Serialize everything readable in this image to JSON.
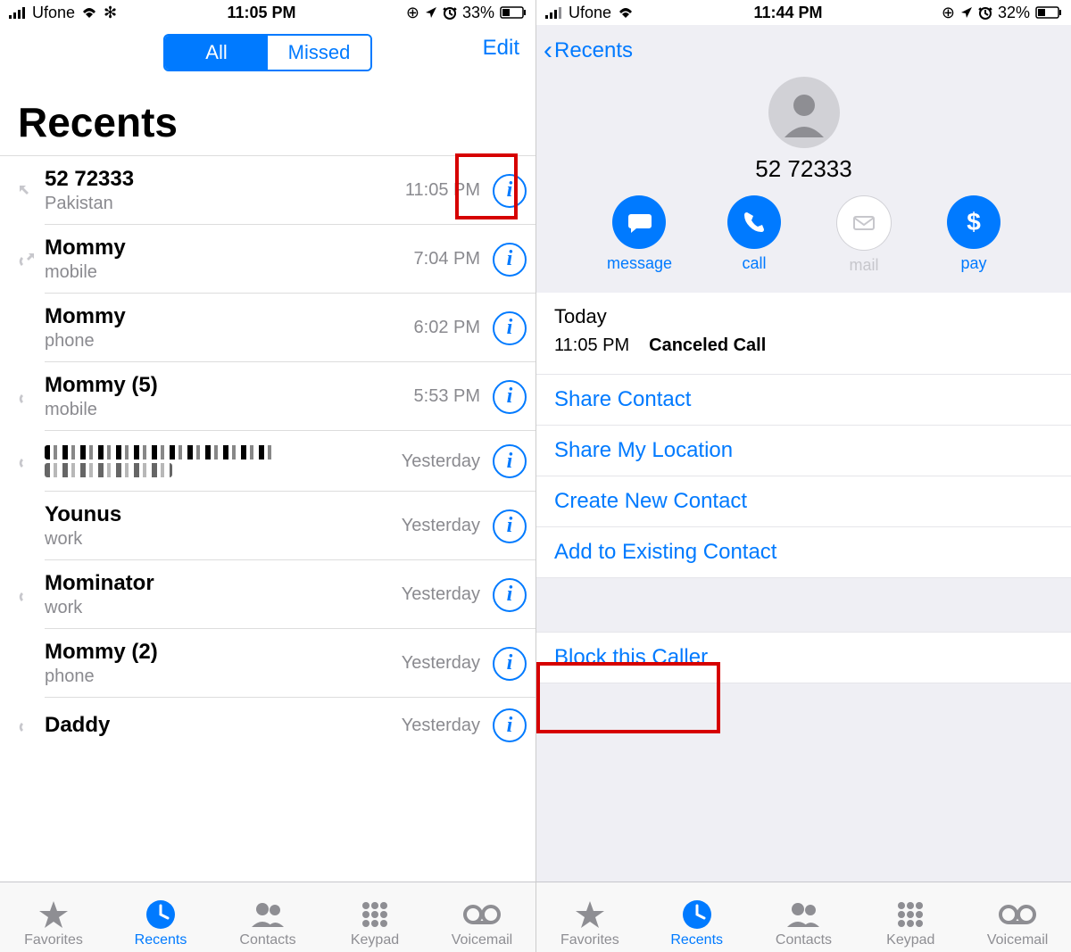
{
  "left": {
    "status": {
      "carrier": "Ufone",
      "time": "11:05 PM",
      "battery": "33%"
    },
    "nav": {
      "all": "All",
      "missed": "Missed",
      "edit": "Edit"
    },
    "heading": "Recents",
    "calls": [
      {
        "name": "52 72333",
        "sub": "Pakistan",
        "time": "11:05 PM",
        "outgoing": true
      },
      {
        "name": "Mommy",
        "sub": "mobile",
        "time": "7:04 PM",
        "outgoing": true
      },
      {
        "name": "Mommy",
        "sub": "phone",
        "time": "6:02 PM",
        "outgoing": false
      },
      {
        "name": "Mommy (5)",
        "sub": "mobile",
        "time": "5:53 PM",
        "outgoing": true
      },
      {
        "name": "[redacted]",
        "sub": "",
        "time": "Yesterday",
        "outgoing": true
      },
      {
        "name": "Younus",
        "sub": "work",
        "time": "Yesterday",
        "outgoing": false
      },
      {
        "name": "Mominator",
        "sub": "work",
        "time": "Yesterday",
        "outgoing": true
      },
      {
        "name": "Mommy (2)",
        "sub": "phone",
        "time": "Yesterday",
        "outgoing": false
      },
      {
        "name": "Daddy",
        "sub": "",
        "time": "Yesterday",
        "outgoing": true
      }
    ]
  },
  "right": {
    "status": {
      "carrier": "Ufone",
      "time": "11:44 PM",
      "battery": "32%"
    },
    "nav": {
      "back": "Recents"
    },
    "contact": {
      "name": "52 72333"
    },
    "actions": {
      "message": "message",
      "call": "call",
      "mail": "mail",
      "pay": "pay"
    },
    "history": {
      "label": "Today",
      "time": "11:05 PM",
      "status": "Canceled Call"
    },
    "options": {
      "shareContact": "Share Contact",
      "shareLocation": "Share My Location",
      "createNew": "Create New Contact",
      "addExisting": "Add to Existing Contact",
      "block": "Block this Caller"
    }
  },
  "tabs": {
    "favorites": "Favorites",
    "recents": "Recents",
    "contacts": "Contacts",
    "keypad": "Keypad",
    "voicemail": "Voicemail"
  }
}
